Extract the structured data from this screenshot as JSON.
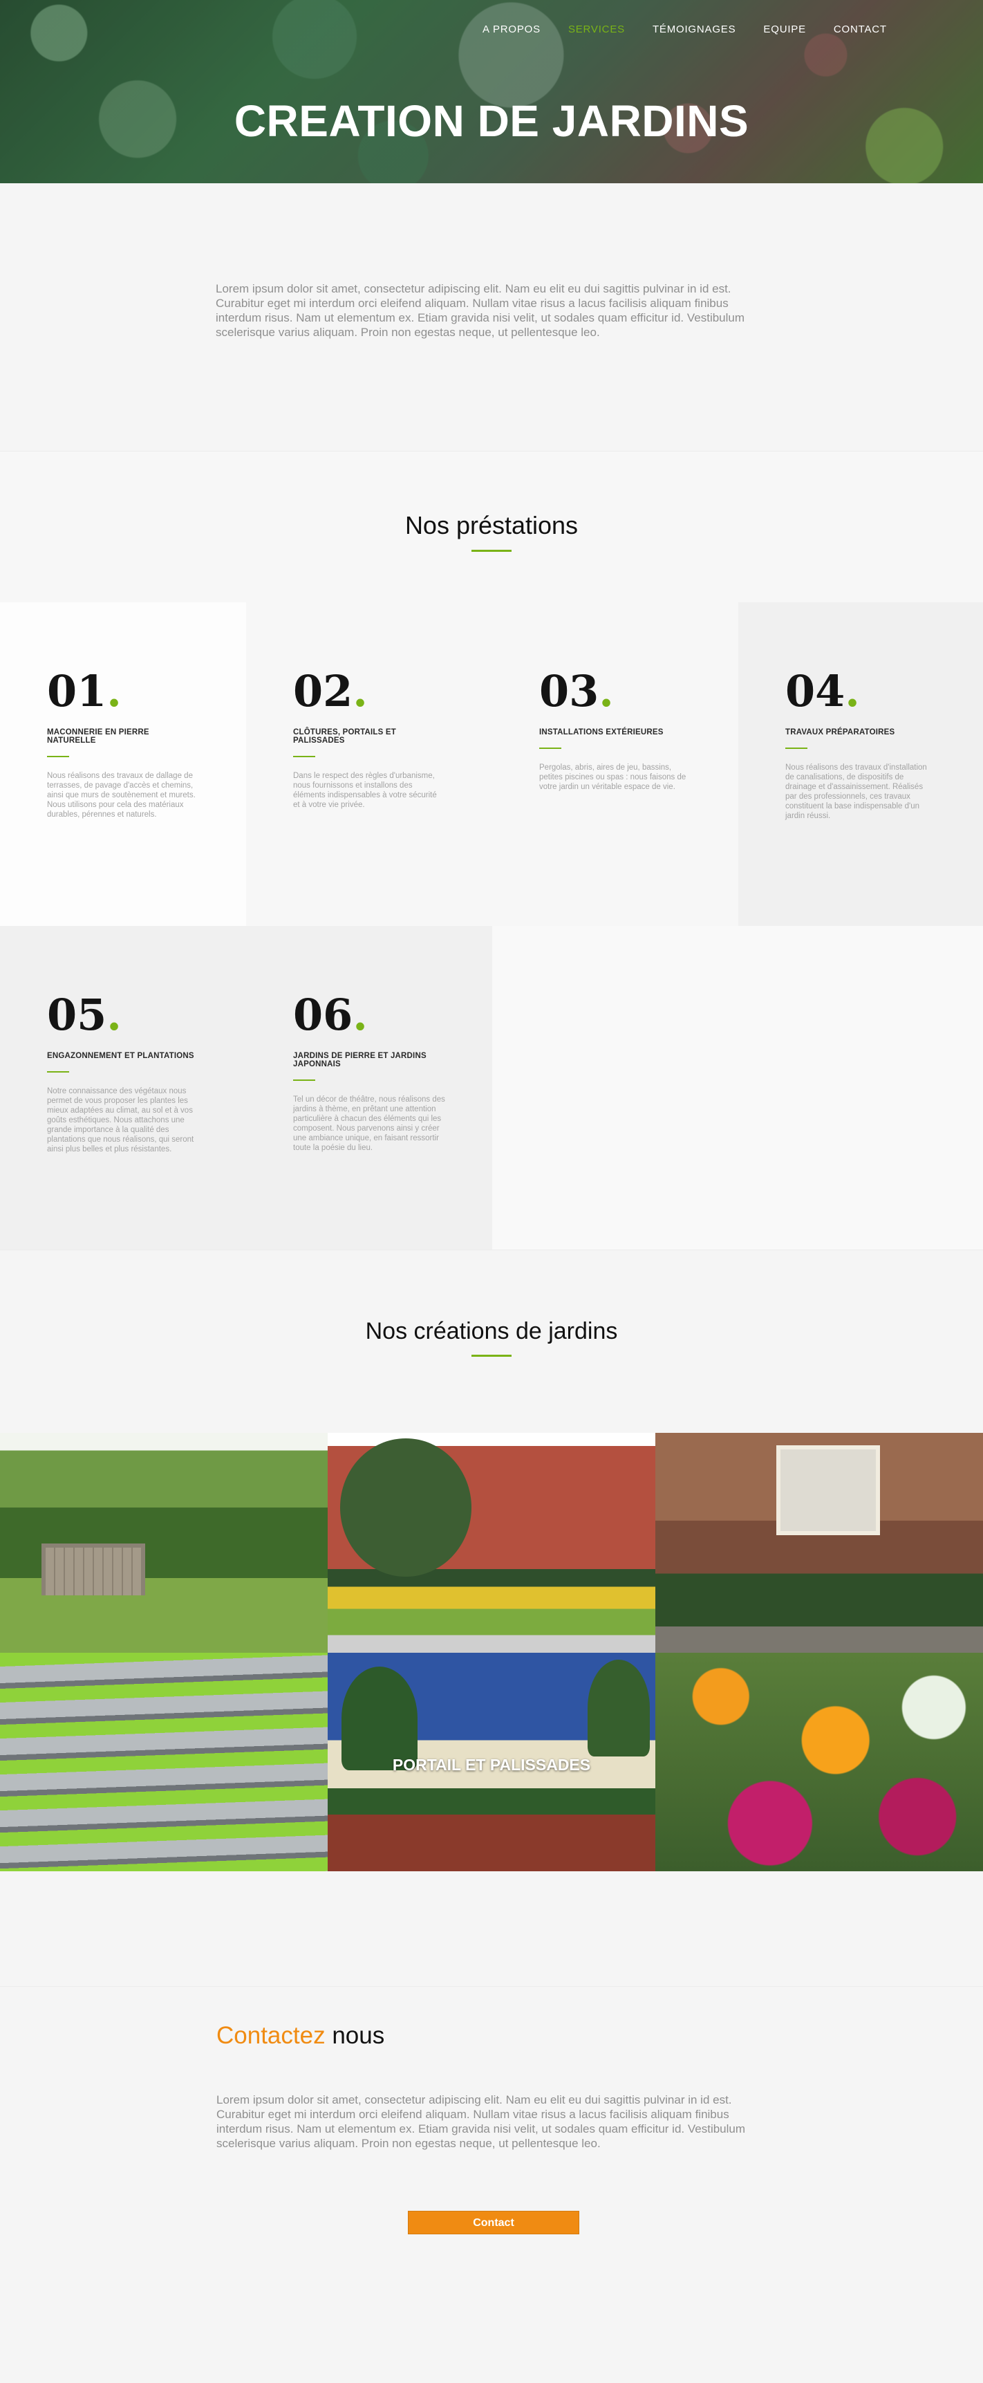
{
  "nav": {
    "items": [
      {
        "label": "A PROPOS",
        "active": false
      },
      {
        "label": "SERVICES",
        "active": true
      },
      {
        "label": "TÉMOIGNAGES",
        "active": false
      },
      {
        "label": "EQUIPE",
        "active": false
      },
      {
        "label": "CONTACT",
        "active": false
      }
    ]
  },
  "hero": {
    "title": "CREATION DE JARDINS"
  },
  "intro": {
    "text": "Lorem ipsum dolor sit amet, consectetur adipiscing elit. Nam eu elit eu dui sagittis pulvinar in id est. Curabitur eget mi interdum orci eleifend aliquam. Nullam vitae risus a lacus facilisis aliquam finibus interdum risus. Nam ut elementum ex. Etiam gravida nisi velit, ut sodales quam efficitur id. Vestibulum scelerisque varius aliquam. Proin non egestas neque, ut pellentesque leo."
  },
  "services": {
    "heading": "Nos préstations",
    "items": [
      {
        "number": "01",
        "title": "MACONNERIE EN PIERRE NATURELLE",
        "text": "Nous réalisons des travaux de dallage de terrasses, de pavage d'accès et chemins, ainsi que murs de soutènement et murets. Nous utilisons pour cela des matériaux durables, pérennes et naturels."
      },
      {
        "number": "02",
        "title": "CLÔTURES, PORTAILS ET PALISSADES",
        "text": "Dans le respect des règles d'urbanisme, nous fournissons et installons des éléments indispensables à votre sécurité et à votre vie privée."
      },
      {
        "number": "03",
        "title": "INSTALLATIONS EXTÉRIEURES",
        "text": "Pergolas, abris, aires de jeu, bassins, petites piscines ou spas : nous faisons de votre jardin un véritable espace de vie."
      },
      {
        "number": "04",
        "title": "TRAVAUX PRÉPARATOIRES",
        "text": "Nous réalisons des travaux d'installation de canalisations, de dispositifs de drainage et d'assainissement. Réalisés par des professionnels, ces travaux constituent la base indispensable d'un jardin réussi."
      },
      {
        "number": "05",
        "title": "ENGAZONNEMENT ET PLANTATIONS",
        "text": "Notre connaissance des végétaux nous permet de vous proposer les plantes les mieux adaptées au climat, au sol et à vos goûts esthétiques. Nous attachons une grande importance à la qualité des plantations que nous réalisons, qui seront ainsi plus belles et plus résistantes."
      },
      {
        "number": "06",
        "title": "JARDINS DE PIERRE ET JARDINS JAPONNAIS",
        "text": "Tel un décor de théâtre, nous réalisons des jardins à thème, en prêtant une attention particulière à chacun des éléments qui les composent. Nous parvenons ainsi y créer une ambiance unique, en faisant ressortir toute la poésie du lieu."
      }
    ]
  },
  "creations": {
    "heading": "Nos créations de jardins",
    "tiles": [
      {
        "caption": ""
      },
      {
        "caption": ""
      },
      {
        "caption": ""
      },
      {
        "caption": ""
      },
      {
        "caption": "PORTAIL ET PALISSADES"
      },
      {
        "caption": ""
      }
    ]
  },
  "contact": {
    "heading_accent": "Contactez",
    "heading_rest": " nous",
    "text": "Lorem ipsum dolor sit amet, consectetur adipiscing elit. Nam eu elit eu dui sagittis pulvinar in id est. Curabitur eget mi interdum orci eleifend aliquam. Nullam vitae risus a lacus facilisis aliquam finibus interdum risus. Nam ut elementum ex. Etiam gravida nisi velit, ut sodales quam efficitur id. Vestibulum scelerisque varius aliquam. Proin non egestas neque, ut pellentesque leo.",
    "button_label": "Contact"
  },
  "colors": {
    "accent_green": "#7ab317",
    "accent_orange": "#f08b12"
  }
}
